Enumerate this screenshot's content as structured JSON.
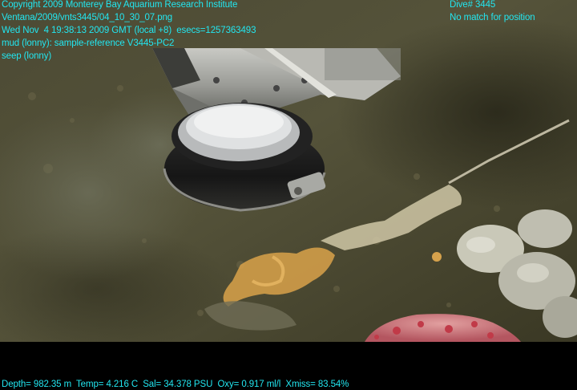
{
  "overlay": {
    "copyright": "Copyright 2009 Monterey Bay Aquarium Research Institute",
    "file_path": "Ventana/2009/vnts3445/04_10_30_07.png",
    "datetime": "Wed Nov  4 19:38:13 2009 GMT (local +8)  esecs=1257363493",
    "annotation_sample": "mud (lonny): sample-reference V3445-PC2",
    "annotation_seep": "seep (lonny)",
    "dive": "Dive# 3445",
    "position": "No match for position",
    "telemetry": "Depth= 982.35 m  Temp= 4.216 C  Sal= 34.378 PSU  Oxy= 0.917 ml/l  Xmiss= 83.54%"
  },
  "colors": {
    "overlay_text": "#22e6f0",
    "background": "#000000",
    "seafloor": "#4d4a32",
    "bacterial_mat": "#d9a24a",
    "sponge": "#c4606a"
  },
  "scene": {
    "subjects": [
      "rov-manipulator-arm",
      "push-core-sampler",
      "seafloor-sediment",
      "bacterial-mat",
      "white-clams",
      "pink-organism",
      "sediment-cloud"
    ]
  }
}
